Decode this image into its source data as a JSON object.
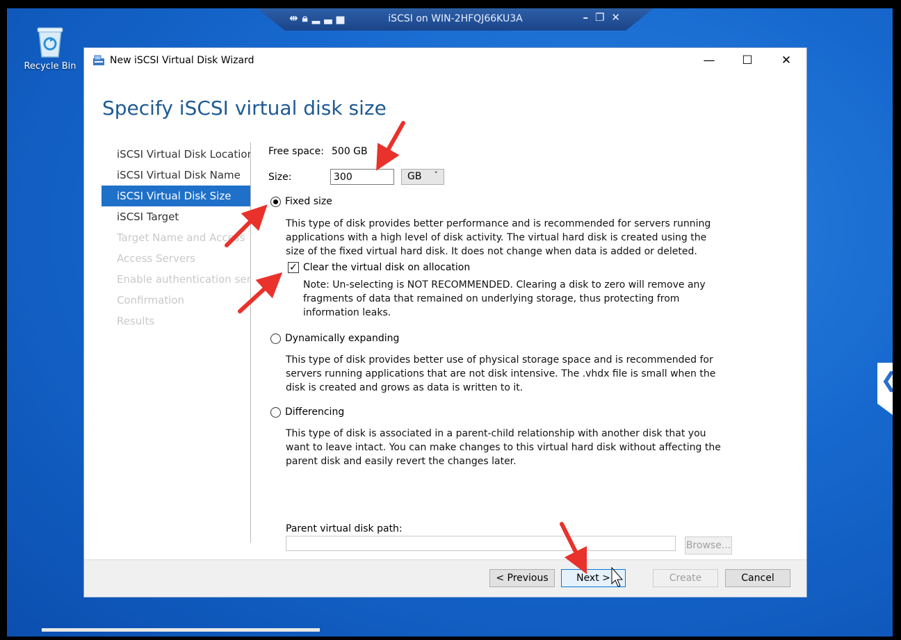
{
  "desktop": {
    "recycle_bin_label": "Recycle Bin"
  },
  "rdp_bar": {
    "title": "iSCSI on WIN-2HFQJ66KU3A"
  },
  "window": {
    "title": "New iSCSI Virtual Disk Wizard",
    "heading": "Specify iSCSI virtual disk size"
  },
  "nav": {
    "items": [
      {
        "label": "iSCSI Virtual Disk Location",
        "state": "normal"
      },
      {
        "label": "iSCSI Virtual Disk Name",
        "state": "normal"
      },
      {
        "label": "iSCSI Virtual Disk Size",
        "state": "active"
      },
      {
        "label": "iSCSI Target",
        "state": "normal"
      },
      {
        "label": "Target Name and Access",
        "state": "disabled"
      },
      {
        "label": "Access Servers",
        "state": "disabled"
      },
      {
        "label": "Enable authentication services",
        "state": "disabled"
      },
      {
        "label": "Confirmation",
        "state": "disabled"
      },
      {
        "label": "Results",
        "state": "disabled"
      }
    ]
  },
  "content": {
    "free_space_label": "Free space:",
    "free_space_value": "500 GB",
    "size_label": "Size:",
    "size_value": "300",
    "size_unit": "GB",
    "fixed": {
      "label": "Fixed size",
      "checked": true,
      "description": "This type of disk provides better performance and is recommended for servers running applications with a high level of disk activity. The virtual hard disk is created using the size of the fixed virtual hard disk. It does not change when data is added or deleted."
    },
    "clear_checkbox": {
      "label": "Clear the virtual disk on allocation",
      "checked": true,
      "note": "Note: Un-selecting is NOT RECOMMENDED. Clearing a disk to zero will remove any fragments of data that remained on underlying storage, thus protecting from information leaks."
    },
    "dynamic": {
      "label": "Dynamically expanding",
      "checked": false,
      "description": "This type of disk provides better use of physical storage space and is recommended for servers running applications that are not disk intensive. The .vhdx file is small when the disk is created and grows as data is written to it."
    },
    "differencing": {
      "label": "Differencing",
      "checked": false,
      "description": "This type of disk is associated in a parent-child relationship with another disk that you want to leave intact. You can make changes to this virtual hard disk without affecting the parent disk and easily revert the changes later.",
      "parent_path_label": "Parent virtual disk path:",
      "parent_path_value": "",
      "browse_label": "Browse..."
    }
  },
  "footer": {
    "previous_label": "< Previous",
    "next_label": "Next >",
    "create_label": "Create",
    "cancel_label": "Cancel"
  },
  "colors": {
    "accent": "#1e70c9",
    "heading": "#1e5a93",
    "annotation_arrow": "#e8322b"
  }
}
